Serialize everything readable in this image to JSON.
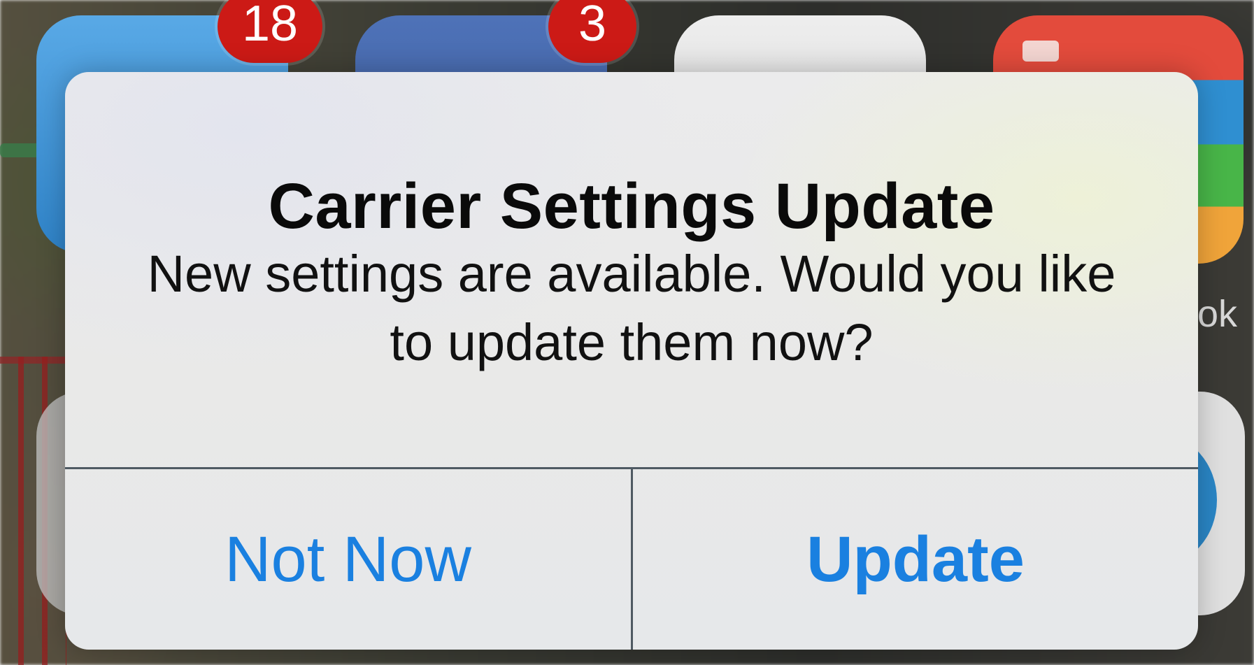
{
  "home_screen": {
    "badges": [
      {
        "count": "18"
      },
      {
        "count": "3"
      }
    ],
    "partial_label": "ok"
  },
  "alert": {
    "title": "Carrier Settings Update",
    "message": "New settings are available.  Would you like to update them now?",
    "buttons": {
      "secondary": "Not Now",
      "primary": "Update"
    }
  },
  "colors": {
    "button_text": "#1a80e0",
    "badge": "#cc1a16",
    "alert_background": "#ebebec",
    "divider": "#4f5a63"
  }
}
